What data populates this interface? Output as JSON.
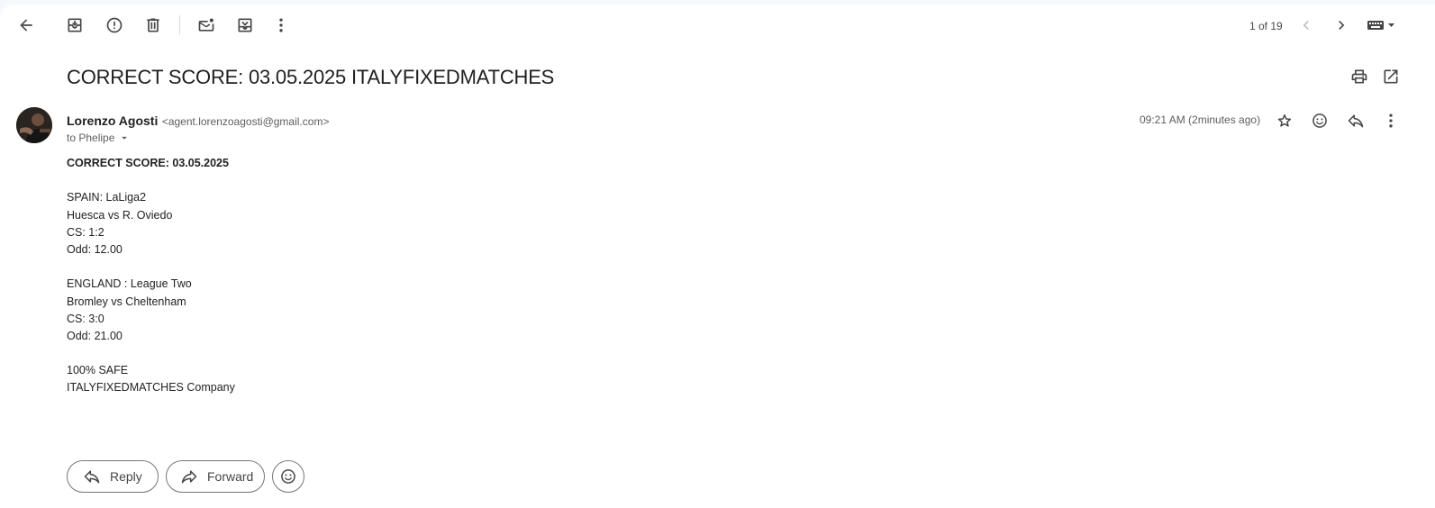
{
  "toolbar": {
    "back_icon": "arrow-left-icon",
    "archive_icon": "archive-icon",
    "spam_icon": "report-spam-icon",
    "delete_icon": "trash-icon",
    "mark_unread_icon": "mark-unread-icon",
    "move_icon": "move-to-icon",
    "more_icon": "more-vert-icon",
    "counter": "1 of 19",
    "prev_icon": "chevron-left-icon",
    "next_icon": "chevron-right-icon",
    "input_tools_icon": "keyboard-icon"
  },
  "subject": "CORRECT SCORE: 03.05.2025 ITALYFIXEDMATCHES",
  "header_actions": {
    "print_icon": "print-icon",
    "new_window_icon": "open-in-new-icon"
  },
  "message": {
    "sender_name": "Lorenzo Agosti",
    "sender_email": "<agent.lorenzoagosti@gmail.com>",
    "recipients": "to Phelipe",
    "time": "09:21 AM (2minutes ago)",
    "body": [
      "CORRECT SCORE: 03.05.2025",
      "",
      "SPAIN: LaLiga2",
      "Huesca vs R. Oviedo",
      "CS: 1:2",
      "Odd: 12.00",
      "",
      "ENGLAND : League Two",
      "Bromley vs Cheltenham",
      "CS: 3:0",
      "Odd: 21.00",
      "",
      "100% SAFE",
      "ITALYFIXEDMATCHES Company"
    ]
  },
  "reply_actions": {
    "reply_label": "Reply",
    "forward_label": "Forward",
    "emoji_icon": "add-reaction-icon"
  }
}
